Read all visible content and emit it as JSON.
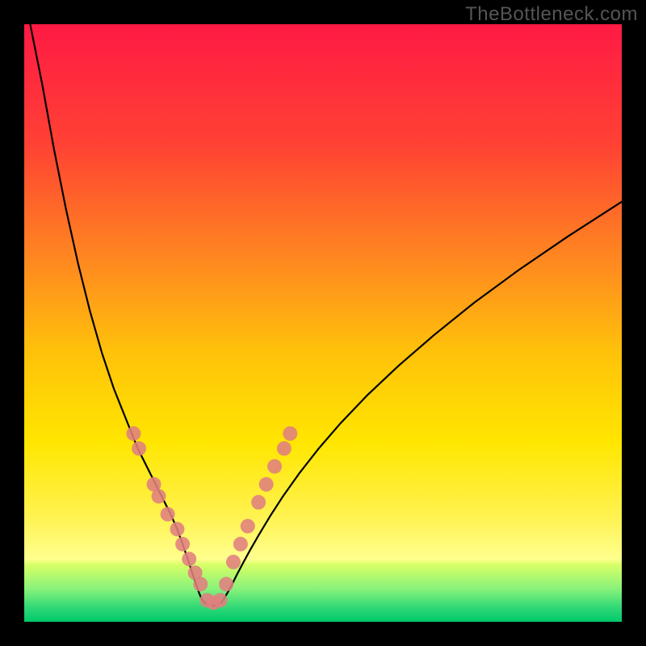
{
  "watermark": "TheBottleneck.com",
  "chart_data": {
    "type": "line",
    "title": "",
    "xlabel": "",
    "ylabel": "",
    "xlim": [
      0,
      100
    ],
    "ylim": [
      0,
      100
    ],
    "axes_visible": false,
    "grid": false,
    "legend": false,
    "background_gradient": {
      "stops": [
        {
          "pos": 0.0,
          "color": "#ff1a44"
        },
        {
          "pos": 0.2,
          "color": "#ff4134"
        },
        {
          "pos": 0.4,
          "color": "#ff8a1f"
        },
        {
          "pos": 0.55,
          "color": "#ffc20a"
        },
        {
          "pos": 0.7,
          "color": "#ffe600"
        },
        {
          "pos": 0.82,
          "color": "#fff24d"
        },
        {
          "pos": 0.895,
          "color": "#ffff8e"
        },
        {
          "pos": 0.905,
          "color": "#d6ff66"
        },
        {
          "pos": 0.945,
          "color": "#88f27a"
        },
        {
          "pos": 0.975,
          "color": "#33d977"
        },
        {
          "pos": 1.0,
          "color": "#00c96b"
        }
      ]
    },
    "series": [
      {
        "name": "left-curve",
        "color": "#000000",
        "width": 2.2,
        "x": [
          1,
          3,
          5,
          7,
          9,
          11,
          13,
          15,
          17,
          19,
          21,
          23,
          24.5,
          25.6,
          26.5,
          27.2,
          27.8,
          28.3,
          28.8,
          29.2,
          29.6
        ],
        "y": [
          100,
          90,
          79,
          69,
          60,
          52,
          45,
          39,
          34,
          29,
          25,
          21,
          18,
          15.5,
          13,
          11,
          9.2,
          7.6,
          6.2,
          5,
          4
        ]
      },
      {
        "name": "right-curve",
        "color": "#000000",
        "width": 2.2,
        "x": [
          33.5,
          34.1,
          34.8,
          35.6,
          36.6,
          37.8,
          39.3,
          41.1,
          43.3,
          46,
          49.2,
          53,
          57.5,
          62.7,
          68.6,
          75.3,
          82.8,
          91,
          100
        ],
        "y": [
          4,
          5,
          6.3,
          7.9,
          9.8,
          12,
          14.6,
          17.6,
          21,
          24.8,
          28.9,
          33.3,
          38,
          42.9,
          48,
          53.4,
          58.9,
          64.5,
          70.3
        ]
      },
      {
        "name": "trough-curve",
        "color": "#000000",
        "width": 2.2,
        "x": [
          29.6,
          30.2,
          30.9,
          31.6,
          32.3,
          33,
          33.5
        ],
        "y": [
          4,
          3.2,
          2.8,
          2.7,
          2.8,
          3.2,
          4
        ]
      }
    ],
    "marker_series": [
      {
        "name": "left-dots",
        "color": "#e08080",
        "radius": 9,
        "points": [
          {
            "x": 18.3,
            "y": 31.5
          },
          {
            "x": 19.2,
            "y": 29
          },
          {
            "x": 21.7,
            "y": 23
          },
          {
            "x": 22.5,
            "y": 21
          },
          {
            "x": 24,
            "y": 18
          },
          {
            "x": 25.6,
            "y": 15.5
          },
          {
            "x": 26.5,
            "y": 13.0
          },
          {
            "x": 27.6,
            "y": 10.5
          },
          {
            "x": 28.6,
            "y": 8.2
          },
          {
            "x": 29.5,
            "y": 6.3
          }
        ]
      },
      {
        "name": "right-dots",
        "color": "#e08080",
        "radius": 9,
        "points": [
          {
            "x": 33.8,
            "y": 6.3
          },
          {
            "x": 35,
            "y": 10
          },
          {
            "x": 36.2,
            "y": 13
          },
          {
            "x": 37.4,
            "y": 16
          },
          {
            "x": 39.2,
            "y": 20
          },
          {
            "x": 40.5,
            "y": 23
          },
          {
            "x": 41.9,
            "y": 26
          },
          {
            "x": 43.5,
            "y": 29
          },
          {
            "x": 44.5,
            "y": 31.5
          }
        ]
      },
      {
        "name": "trough-dots",
        "color": "#e08080",
        "radius": 9,
        "points": [
          {
            "x": 30.6,
            "y": 3.6
          },
          {
            "x": 31.7,
            "y": 3.2
          },
          {
            "x": 32.8,
            "y": 3.6
          }
        ]
      }
    ]
  }
}
